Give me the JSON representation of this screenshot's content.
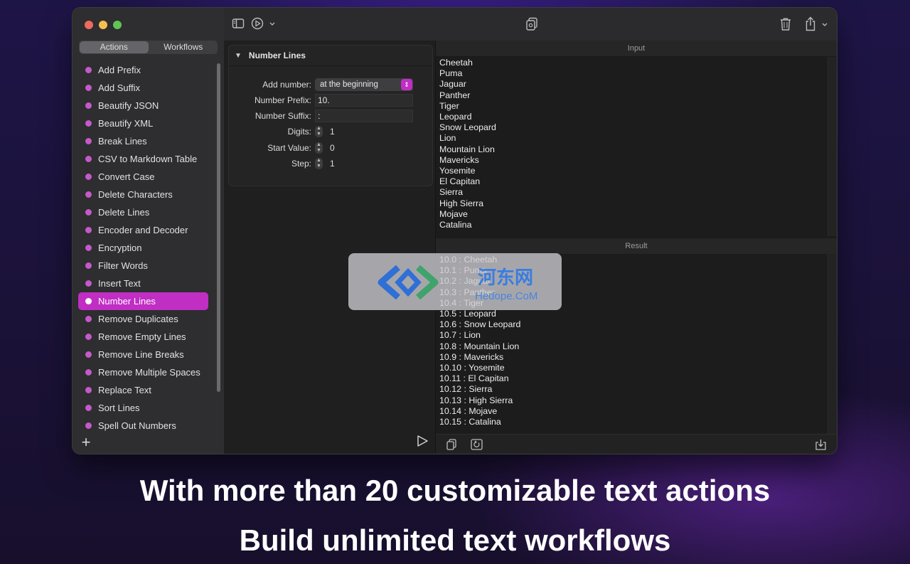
{
  "sidebar": {
    "tabs": [
      {
        "label": "Actions",
        "selected": true
      },
      {
        "label": "Workflows",
        "selected": false
      }
    ],
    "actions": [
      "Add Prefix",
      "Add Suffix",
      "Beautify JSON",
      "Beautify XML",
      "Break Lines",
      "CSV to Markdown Table",
      "Convert Case",
      "Delete Characters",
      "Delete Lines",
      "Encoder and Decoder",
      "Encryption",
      "Filter Words",
      "Insert Text",
      "Number Lines",
      "Remove Duplicates",
      "Remove Empty Lines",
      "Remove Line Breaks",
      "Remove Multiple Spaces",
      "Replace Text",
      "Sort Lines",
      "Spell Out Numbers"
    ],
    "selected_action": "Number Lines",
    "accent_color": "#c02ec4"
  },
  "panel": {
    "title": "Number Lines",
    "add_number_label": "Add number:",
    "add_number_value": "at the beginning",
    "prefix_label": "Number Prefix:",
    "prefix_value": "10.",
    "suffix_label": "Number Suffix:",
    "suffix_value": ":",
    "digits_label": "Digits:",
    "digits_value": "1",
    "start_label": "Start Value:",
    "start_value": "0",
    "step_label": "Step:",
    "step_value": "1"
  },
  "input": {
    "header": "Input",
    "lines": [
      "Cheetah",
      "Puma",
      "Jaguar",
      "Panther",
      "Tiger",
      "Leopard",
      "Snow Leopard",
      "Lion",
      "Mountain Lion",
      "Mavericks",
      "Yosemite",
      "El Capitan",
      "Sierra",
      "High Sierra",
      "Mojave",
      "Catalina"
    ]
  },
  "result": {
    "header": "Result",
    "lines": [
      "10.0 : Cheetah",
      "10.1 : Puma",
      "10.2 : Jaguar",
      "10.3 : Panther",
      "10.4 : Tiger",
      "10.5 : Leopard",
      "10.6 : Snow Leopard",
      "10.7 : Lion",
      "10.8 : Mountain Lion",
      "10.9 : Mavericks",
      "10.10 : Yosemite",
      "10.11 : El Capitan",
      "10.12 : Sierra",
      "10.13 : High Sierra",
      "10.14 : Mojave",
      "10.15 : Catalina"
    ]
  },
  "watermark": {
    "title": "河东网",
    "subtitle": "Hedope.CoM"
  },
  "captions": {
    "line1": "With more than 20 customizable text actions",
    "line2": "Build unlimited text workflows"
  }
}
